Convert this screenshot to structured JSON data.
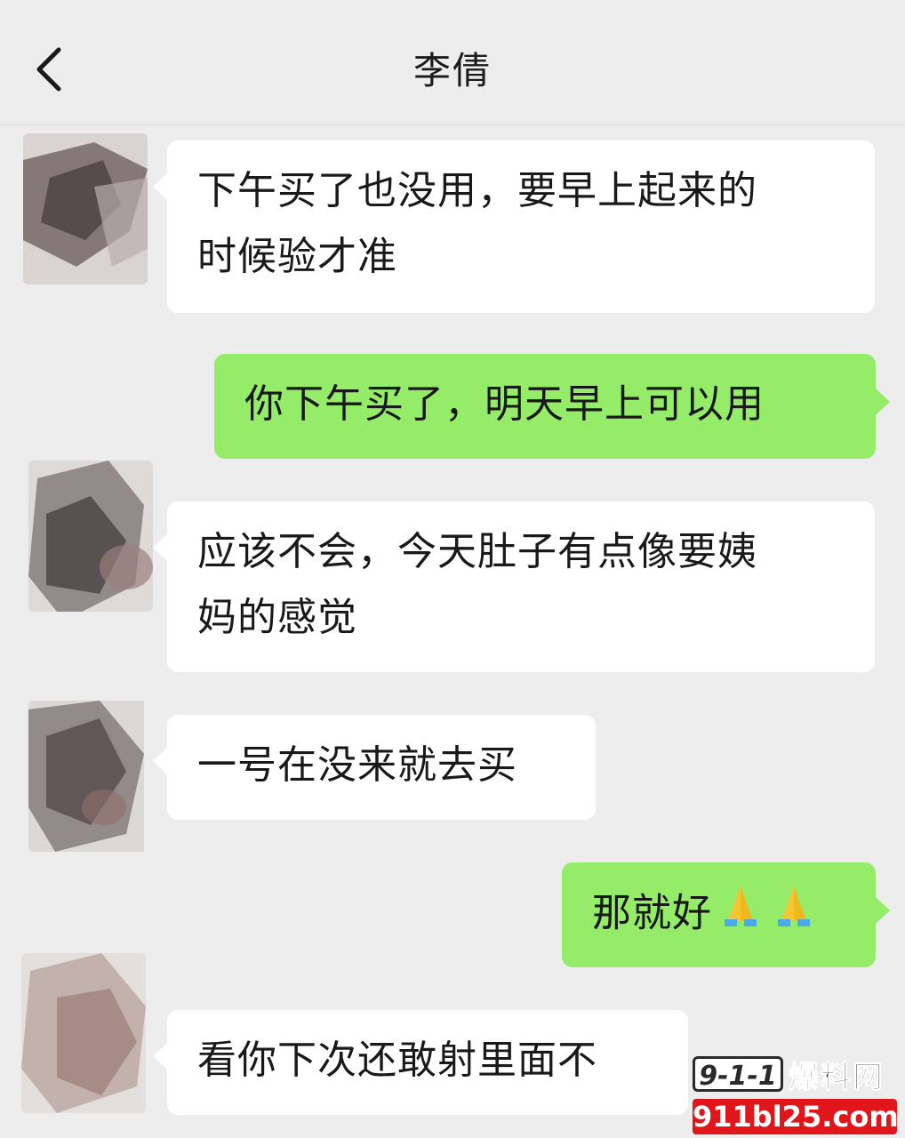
{
  "header": {
    "back_icon": "chevron-left-icon",
    "title": "李倩"
  },
  "messages": [
    {
      "side": "in",
      "text_line1": "下午买了也没用，要早上起来的",
      "text_line2": "时候验才准"
    },
    {
      "side": "out",
      "text": "你下午买了，明天早上可以用"
    },
    {
      "side": "in",
      "text_line1": "应该不会，今天肚子有点像要姨",
      "text_line2": "妈的感觉"
    },
    {
      "side": "in",
      "text": "一号在没来就去买"
    },
    {
      "side": "out",
      "text": "那就好",
      "emoji": [
        "folded-hands-icon",
        "folded-hands-icon"
      ]
    },
    {
      "side": "in",
      "text": "看你下次还敢射里面不"
    }
  ],
  "watermark": {
    "badge": "9-1-1",
    "name": "爆料网",
    "url": "911bl25.com"
  },
  "colors": {
    "background": "#ededed",
    "incoming_bubble": "#ffffff",
    "outgoing_bubble": "#95ec69",
    "watermark_red": "#e0161b"
  }
}
